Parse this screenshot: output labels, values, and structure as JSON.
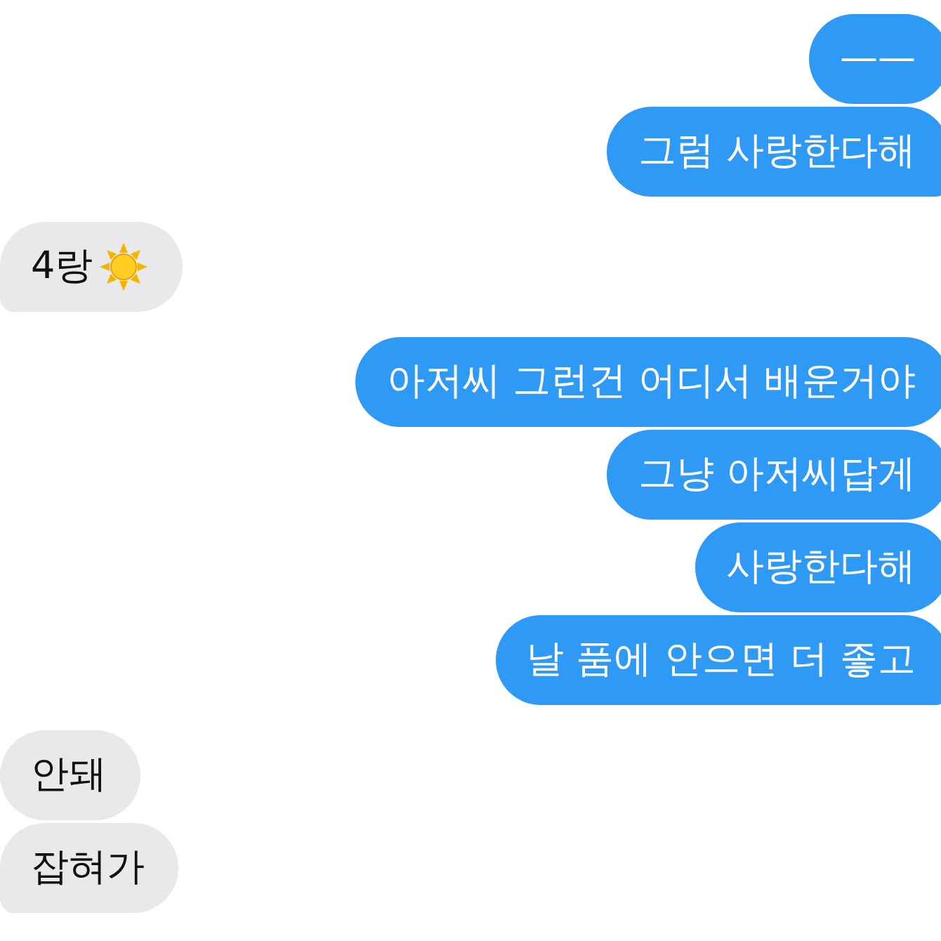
{
  "messages": [
    {
      "kind": "sent",
      "text": "——",
      "tail": false,
      "sun_icon": false
    },
    {
      "kind": "sent",
      "text": "그럼 사랑한다해",
      "tail": true,
      "sun_icon": false
    },
    {
      "kind": "received",
      "text": "4랑",
      "tail": true,
      "sun_icon": true
    },
    {
      "kind": "sent",
      "text": "아저씨 그런건 어디서 배운거야",
      "tail": false,
      "sun_icon": false
    },
    {
      "kind": "sent",
      "text": "그냥 아저씨답게",
      "tail": false,
      "sun_icon": false
    },
    {
      "kind": "sent",
      "text": "사랑한다해",
      "tail": false,
      "sun_icon": false
    },
    {
      "kind": "sent",
      "text": "날 품에 안으면 더 좋고",
      "tail": true,
      "sun_icon": false
    },
    {
      "kind": "received",
      "text": "안돼",
      "tail": false,
      "sun_icon": false
    },
    {
      "kind": "received",
      "text": "잡혀가",
      "tail": true,
      "sun_icon": false
    }
  ]
}
